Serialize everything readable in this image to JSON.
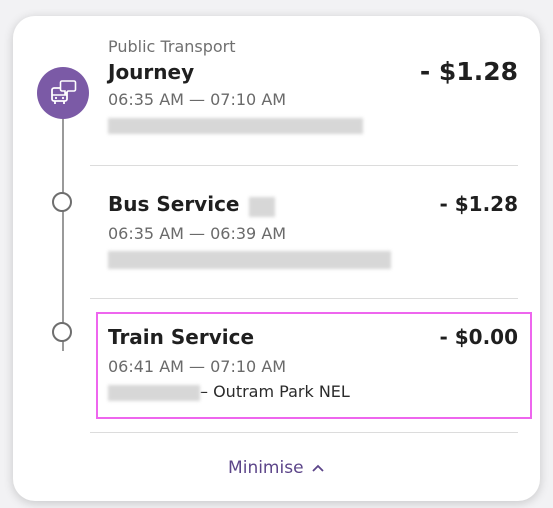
{
  "journey": {
    "category": "Public Transport",
    "title": "Journey",
    "amount": "- $1.28",
    "time": "06:35 AM — 07:10 AM"
  },
  "legs": [
    {
      "title": "Bus Service",
      "amount": "- $1.28",
      "time": "06:35 AM — 06:39 AM"
    },
    {
      "title": "Train Service",
      "amount": "- $0.00",
      "time": "06:41 AM — 07:10 AM",
      "route_end": "– Outram Park NEL"
    }
  ],
  "footer": {
    "minimise_label": "Minimise"
  },
  "icons": {
    "journey": "transit-chat-icon",
    "minimise": "chevron-up-icon"
  },
  "colors": {
    "accent": "#7b5aa6",
    "link": "#5c4589",
    "highlight": "#ee66ee"
  }
}
